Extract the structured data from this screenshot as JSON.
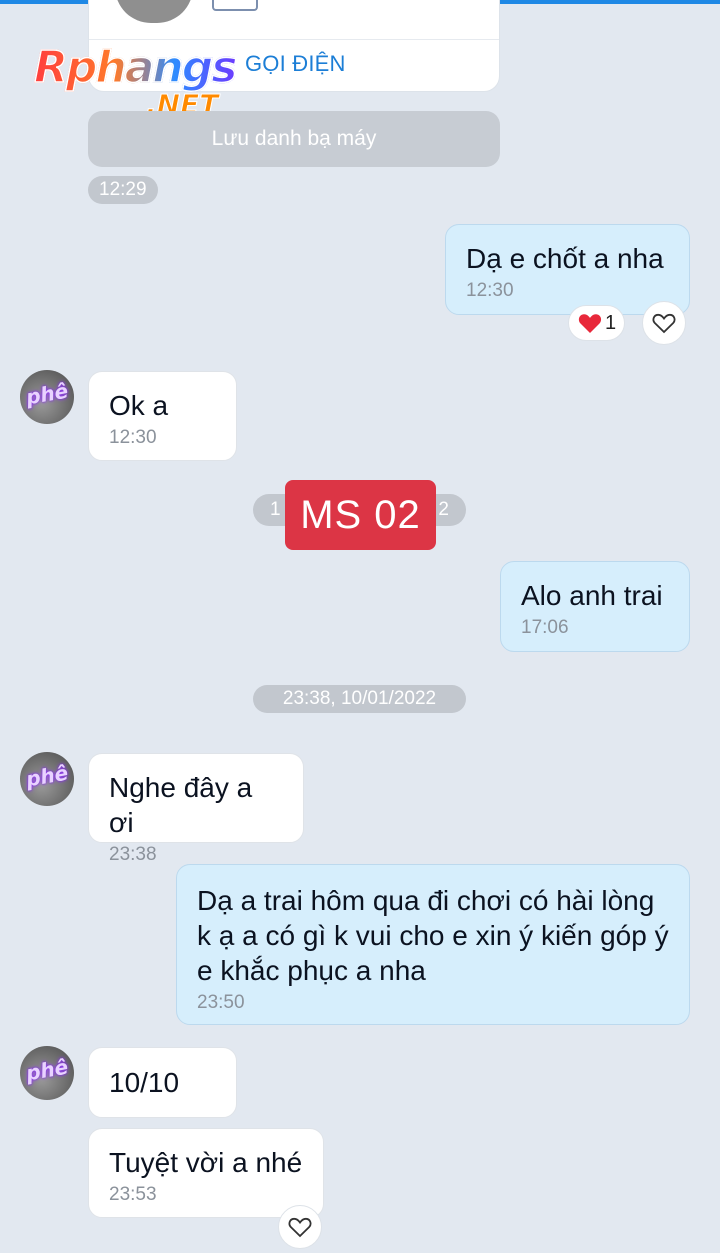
{
  "contact_card": {
    "call_label": "GỌI ĐIỆN"
  },
  "watermark": {
    "logo_main": "Rphangs",
    "logo_sub": ".NET"
  },
  "system": {
    "save_contact": "Lưu danh bạ máy",
    "ms_badge": "MS 02",
    "hidden_pill_left": "1",
    "hidden_pill_right": "2"
  },
  "timestamps": {
    "t1": "12:29",
    "date_divider": "23:38, 10/01/2022"
  },
  "avatars": {
    "label": "phê"
  },
  "reactions": {
    "heart_count": "1"
  },
  "messages": [
    {
      "direction": "out",
      "text": "Dạ e chốt a nha",
      "time": "12:30"
    },
    {
      "direction": "in",
      "text": "Ok a",
      "time": "12:30"
    },
    {
      "direction": "out",
      "text": "Alo anh trai",
      "time": "17:06"
    },
    {
      "direction": "in",
      "text": "Nghe đây a ơi",
      "time": "23:38"
    },
    {
      "direction": "out",
      "text": "Dạ a trai hôm qua đi chơi có hài lòng k ạ a có gì k vui cho e xin ý kiến góp ý e khắc phục a nha",
      "time": "23:50"
    },
    {
      "direction": "in",
      "text": "10/10",
      "time": ""
    },
    {
      "direction": "in",
      "text": "Tuyệt vời a nhé",
      "time": "23:53"
    }
  ],
  "colors": {
    "accent": "#1e88e5",
    "out_bubble": "#d6eefc",
    "badge_red": "#dc3545",
    "background": "#e2e8f0"
  }
}
